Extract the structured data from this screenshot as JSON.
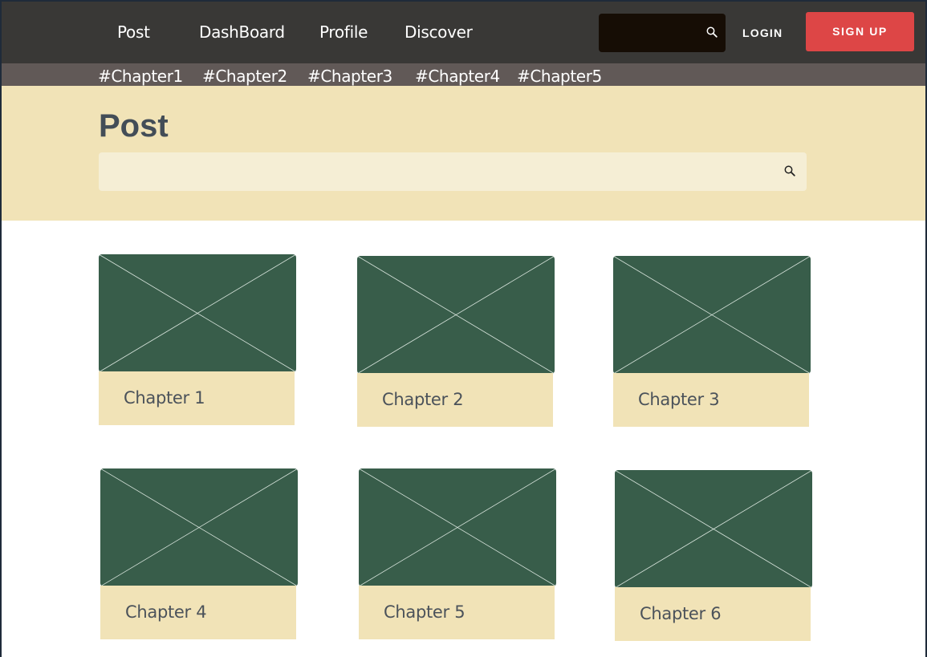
{
  "nav": {
    "links": [
      "Post",
      "DashBoard",
      "Profile",
      "Discover"
    ],
    "login_label": "LOGIN",
    "signup_label": "SIGN UP"
  },
  "tags": [
    "#Chapter1",
    "#Chapter2",
    "#Chapter3",
    "#Chapter4",
    "#Chapter5"
  ],
  "header": {
    "title": "Post"
  },
  "cards": [
    {
      "label": "Chapter 1"
    },
    {
      "label": "Chapter 2"
    },
    {
      "label": "Chapter 3"
    },
    {
      "label": "Chapter 4"
    },
    {
      "label": "Chapter 5"
    },
    {
      "label": "Chapter 6"
    }
  ],
  "colors": {
    "topnav_bg": "#393836",
    "tagbar_bg": "#615957",
    "band_bg": "#f1e3b7",
    "signup_bg": "#dd4646",
    "thumb_bg": "#385d4a"
  },
  "icons": {
    "search": "search-icon",
    "placeholder_image": "image-placeholder-icon"
  }
}
